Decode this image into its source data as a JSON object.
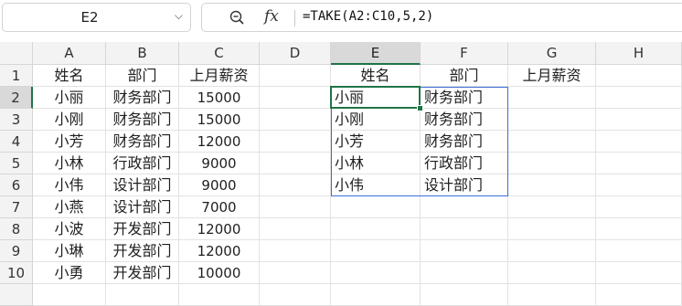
{
  "formula_bar": {
    "cell_ref": "E2",
    "fx_label": "fx",
    "formula": "=TAKE(A2:C10,5,2)"
  },
  "columns": [
    "A",
    "B",
    "C",
    "D",
    "E",
    "F",
    "G",
    "H"
  ],
  "rows": [
    "1",
    "2",
    "3",
    "4",
    "5",
    "6",
    "7",
    "8",
    "9",
    "10"
  ],
  "source_table": {
    "header": [
      "姓名",
      "部门",
      "上月薪资"
    ],
    "rows": [
      [
        "小丽",
        "财务部门",
        "15000"
      ],
      [
        "小刚",
        "财务部门",
        "15000"
      ],
      [
        "小芳",
        "财务部门",
        "12000"
      ],
      [
        "小林",
        "行政部门",
        "9000"
      ],
      [
        "小伟",
        "设计部门",
        "9000"
      ],
      [
        "小燕",
        "设计部门",
        "7000"
      ],
      [
        "小波",
        "开发部门",
        "12000"
      ],
      [
        "小琳",
        "开发部门",
        "12000"
      ],
      [
        "小勇",
        "开发部门",
        "10000"
      ]
    ]
  },
  "result_table": {
    "header": [
      "姓名",
      "部门",
      "上月薪资"
    ],
    "rows": [
      [
        "小丽",
        "财务部门"
      ],
      [
        "小刚",
        "财务部门"
      ],
      [
        "小芳",
        "财务部门"
      ],
      [
        "小林",
        "行政部门"
      ],
      [
        "小伟",
        "设计部门"
      ]
    ]
  }
}
